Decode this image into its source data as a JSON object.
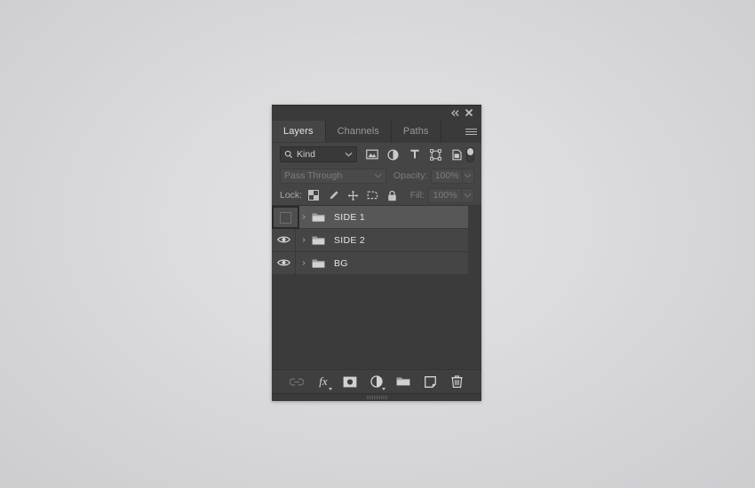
{
  "panel": {
    "titlebar": {
      "collapse_label": "◂◂",
      "collapse_icon": "double-chevron-left-icon",
      "close_label": "✕",
      "close_icon": "close-icon"
    },
    "tabs": [
      {
        "label": "Layers",
        "active": true
      },
      {
        "label": "Channels",
        "active": false
      },
      {
        "label": "Paths",
        "active": false
      }
    ],
    "menu_icon": "hamburger-menu-icon",
    "filter_row": {
      "search_icon": "search-icon",
      "kind_label": "Kind",
      "caret": "∨",
      "icons": [
        {
          "name": "pixel-layer-filter-icon"
        },
        {
          "name": "adjustment-layer-filter-icon"
        },
        {
          "name": "type-layer-filter-icon",
          "label": "T"
        },
        {
          "name": "shape-layer-filter-icon"
        },
        {
          "name": "smart-object-filter-icon"
        }
      ],
      "toggle_name": "filter-enable-toggle"
    },
    "blend_row": {
      "blend_mode": "Pass Through",
      "caret": "∨",
      "opacity_label": "Opacity:",
      "opacity_value": "100%"
    },
    "lock_row": {
      "lock_label": "Lock:",
      "icons": [
        {
          "name": "lock-transparent-pixels-icon"
        },
        {
          "name": "lock-image-pixels-icon"
        },
        {
          "name": "lock-position-icon"
        },
        {
          "name": "lock-artboard-nesting-icon"
        },
        {
          "name": "lock-all-icon"
        }
      ],
      "fill_label": "Fill:",
      "fill_value": "100%"
    },
    "layers": [
      {
        "name": "SIDE 1",
        "visible": false,
        "selected": true,
        "highlighted": true
      },
      {
        "name": "SIDE 2",
        "visible": true,
        "selected": false,
        "highlighted": false
      },
      {
        "name": "BG",
        "visible": true,
        "selected": false,
        "highlighted": false
      }
    ],
    "layer_icons": {
      "eye": "eye-visibility-icon",
      "expand": "›",
      "folder": "layer-group-folder-icon"
    },
    "bottom_toolbar": [
      {
        "name": "link-layers-button",
        "label": "",
        "dim": true
      },
      {
        "name": "layer-style-fx-button",
        "label": "fx",
        "dim": false
      },
      {
        "name": "add-layer-mask-button",
        "label": "",
        "dim": false
      },
      {
        "name": "new-adjustment-layer-button",
        "label": "",
        "dim": false
      },
      {
        "name": "new-group-button",
        "label": "",
        "dim": false
      },
      {
        "name": "new-layer-button",
        "label": "",
        "dim": false
      },
      {
        "name": "delete-layer-button",
        "label": "",
        "dim": false
      }
    ]
  },
  "colors": {
    "panel_bg": "#454545",
    "row_selected": "#575757",
    "row_normal": "#454545",
    "tab_active": "#454545",
    "desktop_bg": "#dcdcde"
  }
}
